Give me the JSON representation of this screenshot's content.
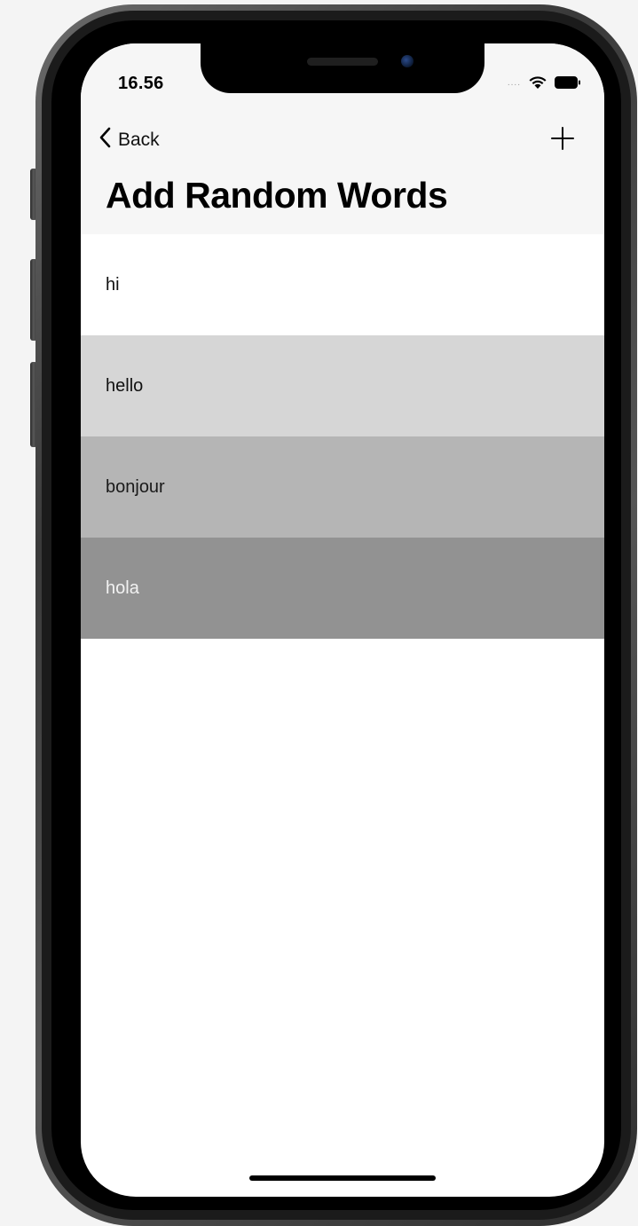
{
  "status_bar": {
    "time": "16.56",
    "signal_dots": "....",
    "wifi_icon": "wifi-icon",
    "battery_icon": "battery-icon"
  },
  "nav": {
    "back_label": "Back",
    "back_icon": "chevron-left-icon",
    "add_icon": "plus-icon",
    "title": "Add Random Words"
  },
  "words": [
    {
      "text": "hi",
      "background": "#ffffff",
      "color": "#111111"
    },
    {
      "text": "hello",
      "background": "#d6d6d6",
      "color": "#111111"
    },
    {
      "text": "bonjour",
      "background": "#b5b5b5",
      "color": "#1a1a1a"
    },
    {
      "text": "hola",
      "background": "#929292",
      "color": "#f2f2f2"
    }
  ]
}
